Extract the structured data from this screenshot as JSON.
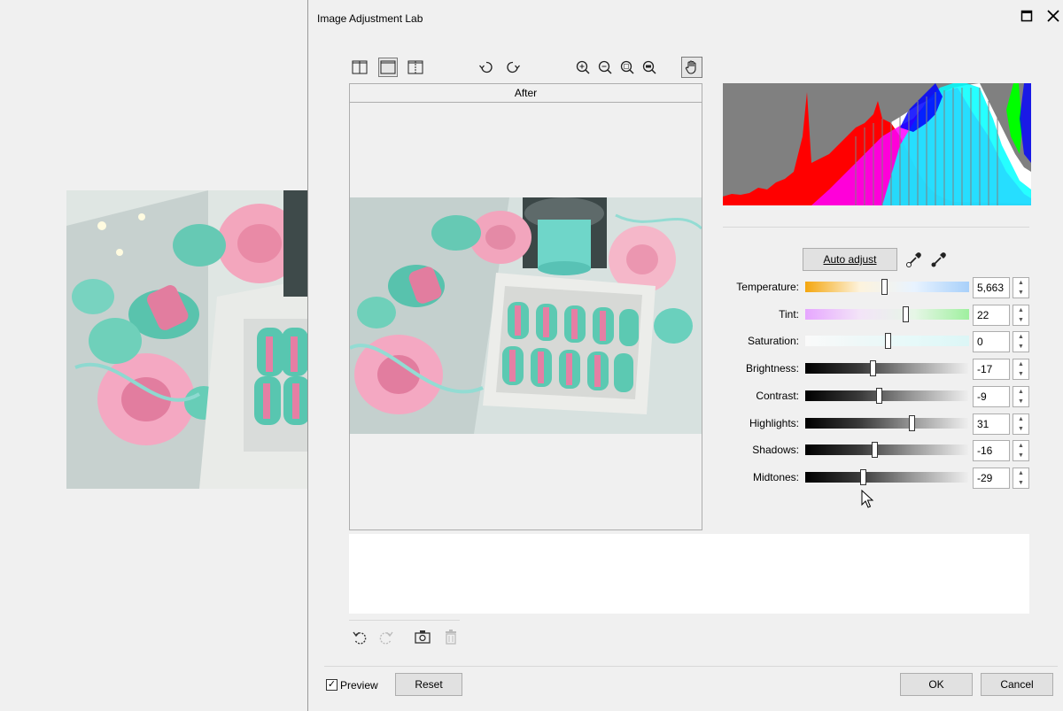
{
  "dialog": {
    "title": "Image Adjustment Lab"
  },
  "window_buttons": {
    "maximize_icon": "maximize-icon",
    "close_icon": "close-icon"
  },
  "view_toolbar": [
    "split-view-icon",
    "single-view-icon",
    "side-by-side-view-icon"
  ],
  "rotate_toolbar": [
    "rotate-left-icon",
    "rotate-right-icon"
  ],
  "zoom_toolbar": [
    "zoom-in-icon",
    "zoom-out-icon",
    "zoom-fit-icon",
    "zoom-100-icon",
    "pan-hand-icon"
  ],
  "preview": {
    "header": "After"
  },
  "histogram": {
    "colors": [
      "#ff0000",
      "#ff00ff",
      "#00ffff",
      "#0000ff",
      "#00ff00",
      "#ffffff",
      "#808080"
    ]
  },
  "auto_adjust": {
    "label": "Auto adjust"
  },
  "eyedroppers": [
    "white-point-eyedropper-icon",
    "black-point-eyedropper-icon"
  ],
  "sliders": [
    {
      "label": "Temperature:",
      "value": "5,663",
      "level": 0.48,
      "track": [
        "#f4a60e",
        "#fdf3dd",
        "#e8f3ff",
        "#a8d0fa"
      ]
    },
    {
      "label": "Tint:",
      "value": "22",
      "level": 0.61,
      "track": [
        "#e6a6ff",
        "#f3e4f8",
        "#e6f6e6",
        "#9ff09f"
      ]
    },
    {
      "label": "Saturation:",
      "value": "0",
      "level": 0.5,
      "track": [
        "#fafafa",
        "#eef8f8",
        "#e6f9f9",
        "#dcf6f6"
      ]
    },
    {
      "label": "Brightness:",
      "value": "-17",
      "level": 0.41,
      "track": [
        "#000000",
        "#3a3a3a",
        "#9c9c9c",
        "#f0f0f0"
      ]
    },
    {
      "label": "Contrast:",
      "value": "-9",
      "level": 0.45,
      "track": [
        "#000000",
        "#3a3a3a",
        "#9c9c9c",
        "#f0f0f0"
      ]
    },
    {
      "label": "Highlights:",
      "value": "31",
      "level": 0.65,
      "track": [
        "#000000",
        "#3a3a3a",
        "#9c9c9c",
        "#f0f0f0"
      ]
    },
    {
      "label": "Shadows:",
      "value": "-16",
      "level": 0.42,
      "track": [
        "#000000",
        "#3a3a3a",
        "#9c9c9c",
        "#f0f0f0"
      ]
    },
    {
      "label": "Midtones:",
      "value": "-29",
      "level": 0.35,
      "track": [
        "#000000",
        "#3a3a3a",
        "#9c9c9c",
        "#f0f0f0"
      ]
    }
  ],
  "history_toolbar": [
    "undo-icon",
    "redo-icon",
    "snapshot-icon",
    "delete-icon"
  ],
  "footer": {
    "preview_label": "Preview",
    "preview_checked": true,
    "reset_label": "Reset",
    "ok_label": "OK",
    "cancel_label": "Cancel"
  }
}
